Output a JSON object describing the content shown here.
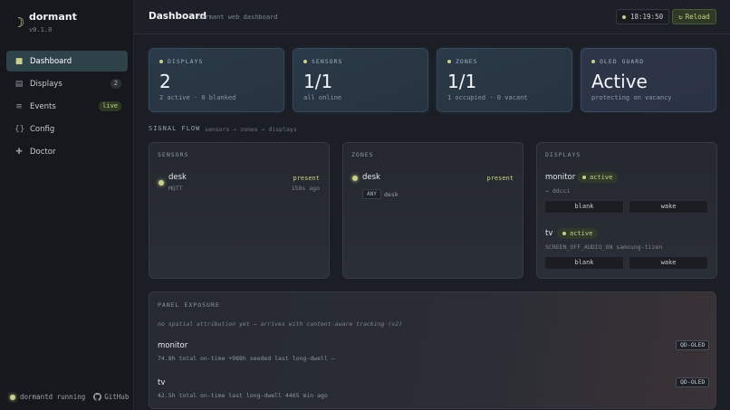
{
  "brand": {
    "name": "dormant",
    "version": "v0.1.0",
    "icon": "crescent-moon-icon",
    "accent": "#c8d08a"
  },
  "nav": {
    "items": [
      {
        "label": "Dashboard",
        "icon": "square-icon",
        "badge": "",
        "active": true
      },
      {
        "label": "Displays",
        "icon": "list-icon",
        "badge": "2",
        "active": false
      },
      {
        "label": "Events",
        "icon": "lines-icon",
        "badge": "live",
        "active": false
      },
      {
        "label": "Config",
        "icon": "braces-icon",
        "badge": "",
        "active": false
      },
      {
        "label": "Doctor",
        "icon": "plus-icon",
        "badge": "",
        "active": false
      }
    ]
  },
  "footer": {
    "status": "dormantd running",
    "github": "GitHub"
  },
  "header": {
    "title": "Dashboard",
    "subtitle": "dormant web dashboard",
    "clock": "18:19:50",
    "reload": "Reload"
  },
  "stats": [
    {
      "label": "DISPLAYS",
      "value": "2",
      "sub": "2 active · 0 blanked"
    },
    {
      "label": "SENSORS",
      "value": "1/1",
      "sub": "all online"
    },
    {
      "label": "ZONES",
      "value": "1/1",
      "sub": "1 occupied · 0 vacant"
    },
    {
      "label": "OLED GUARD",
      "value": "Active",
      "sub": "protecting on vacancy"
    }
  ],
  "signal_flow": {
    "title": "SIGNAL FLOW",
    "subtitle": "sensors → zones → displays",
    "sensors": {
      "title": "SENSORS",
      "items": [
        {
          "name": "desk",
          "source": "MQTT",
          "status": "present",
          "age": "158s ago"
        }
      ]
    },
    "zones": {
      "title": "ZONES",
      "items": [
        {
          "name": "desk",
          "status": "present",
          "rule": "ANY",
          "members": "desk"
        }
      ]
    },
    "displays": {
      "title": "DISPLAYS",
      "items": [
        {
          "name": "monitor",
          "status": "active",
          "backend": "→ ddcci",
          "blank": "blank",
          "wake": "wake"
        },
        {
          "name": "tv",
          "status": "active",
          "backend": "SCREEN_OFF_AUDIO_ON  samsung-tizen",
          "blank": "blank",
          "wake": "wake"
        }
      ]
    }
  },
  "exposure": {
    "title": "PANEL EXPOSURE",
    "note": "no spatial attribution yet — arrives with content-aware tracking (v2)",
    "items": [
      {
        "name": "monitor",
        "tag": "QD-OLED",
        "stats": "74.8h total on-time  +988h seeded  last long-dwell —"
      },
      {
        "name": "tv",
        "tag": "QD-OLED",
        "stats": "42.5h total on-time  last long-dwell 4465 min ago"
      }
    ]
  }
}
